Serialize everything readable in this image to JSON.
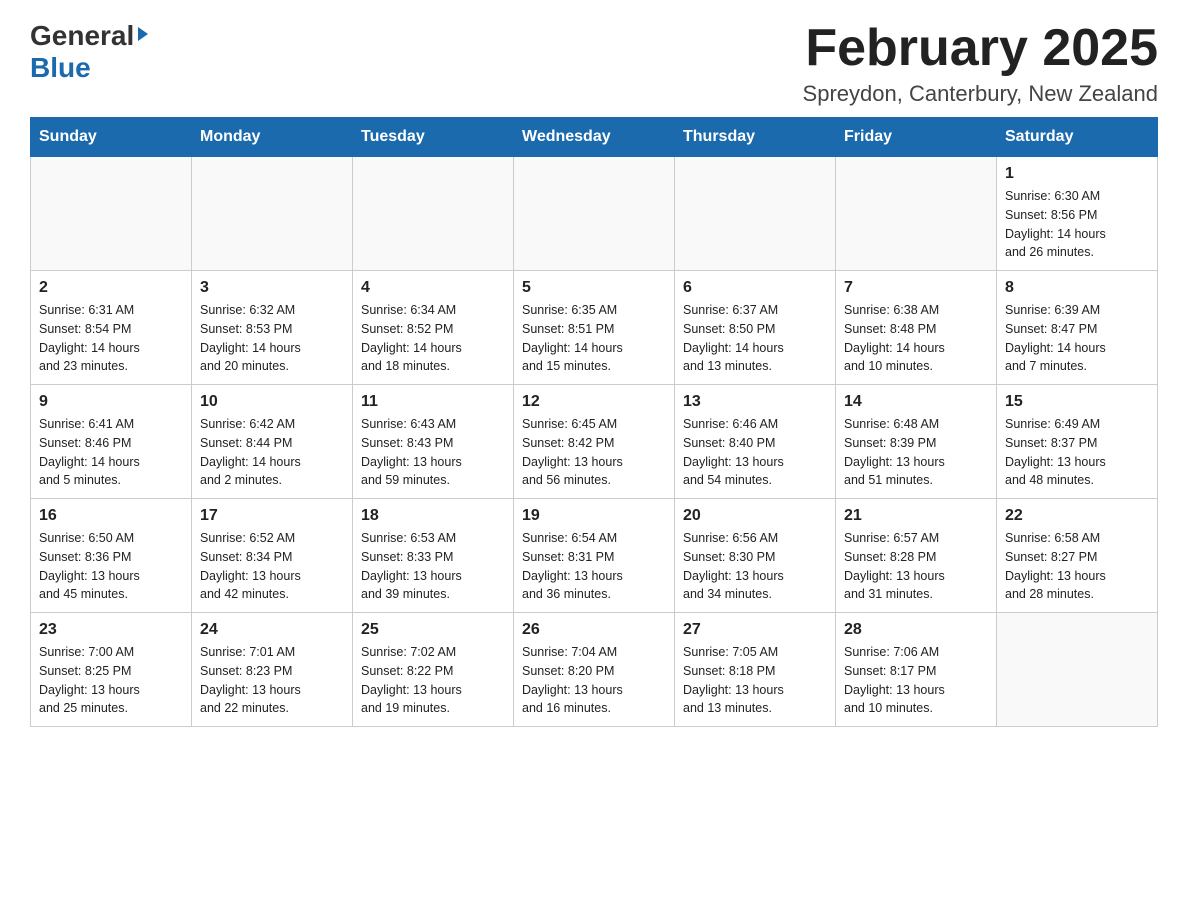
{
  "header": {
    "logo_text_dark": "General",
    "logo_text_blue": "Blue",
    "month_year": "February 2025",
    "location": "Spreydon, Canterbury, New Zealand"
  },
  "calendar": {
    "days_of_week": [
      "Sunday",
      "Monday",
      "Tuesday",
      "Wednesday",
      "Thursday",
      "Friday",
      "Saturday"
    ],
    "weeks": [
      [
        {
          "day": "",
          "info": ""
        },
        {
          "day": "",
          "info": ""
        },
        {
          "day": "",
          "info": ""
        },
        {
          "day": "",
          "info": ""
        },
        {
          "day": "",
          "info": ""
        },
        {
          "day": "",
          "info": ""
        },
        {
          "day": "1",
          "info": "Sunrise: 6:30 AM\nSunset: 8:56 PM\nDaylight: 14 hours\nand 26 minutes."
        }
      ],
      [
        {
          "day": "2",
          "info": "Sunrise: 6:31 AM\nSunset: 8:54 PM\nDaylight: 14 hours\nand 23 minutes."
        },
        {
          "day": "3",
          "info": "Sunrise: 6:32 AM\nSunset: 8:53 PM\nDaylight: 14 hours\nand 20 minutes."
        },
        {
          "day": "4",
          "info": "Sunrise: 6:34 AM\nSunset: 8:52 PM\nDaylight: 14 hours\nand 18 minutes."
        },
        {
          "day": "5",
          "info": "Sunrise: 6:35 AM\nSunset: 8:51 PM\nDaylight: 14 hours\nand 15 minutes."
        },
        {
          "day": "6",
          "info": "Sunrise: 6:37 AM\nSunset: 8:50 PM\nDaylight: 14 hours\nand 13 minutes."
        },
        {
          "day": "7",
          "info": "Sunrise: 6:38 AM\nSunset: 8:48 PM\nDaylight: 14 hours\nand 10 minutes."
        },
        {
          "day": "8",
          "info": "Sunrise: 6:39 AM\nSunset: 8:47 PM\nDaylight: 14 hours\nand 7 minutes."
        }
      ],
      [
        {
          "day": "9",
          "info": "Sunrise: 6:41 AM\nSunset: 8:46 PM\nDaylight: 14 hours\nand 5 minutes."
        },
        {
          "day": "10",
          "info": "Sunrise: 6:42 AM\nSunset: 8:44 PM\nDaylight: 14 hours\nand 2 minutes."
        },
        {
          "day": "11",
          "info": "Sunrise: 6:43 AM\nSunset: 8:43 PM\nDaylight: 13 hours\nand 59 minutes."
        },
        {
          "day": "12",
          "info": "Sunrise: 6:45 AM\nSunset: 8:42 PM\nDaylight: 13 hours\nand 56 minutes."
        },
        {
          "day": "13",
          "info": "Sunrise: 6:46 AM\nSunset: 8:40 PM\nDaylight: 13 hours\nand 54 minutes."
        },
        {
          "day": "14",
          "info": "Sunrise: 6:48 AM\nSunset: 8:39 PM\nDaylight: 13 hours\nand 51 minutes."
        },
        {
          "day": "15",
          "info": "Sunrise: 6:49 AM\nSunset: 8:37 PM\nDaylight: 13 hours\nand 48 minutes."
        }
      ],
      [
        {
          "day": "16",
          "info": "Sunrise: 6:50 AM\nSunset: 8:36 PM\nDaylight: 13 hours\nand 45 minutes."
        },
        {
          "day": "17",
          "info": "Sunrise: 6:52 AM\nSunset: 8:34 PM\nDaylight: 13 hours\nand 42 minutes."
        },
        {
          "day": "18",
          "info": "Sunrise: 6:53 AM\nSunset: 8:33 PM\nDaylight: 13 hours\nand 39 minutes."
        },
        {
          "day": "19",
          "info": "Sunrise: 6:54 AM\nSunset: 8:31 PM\nDaylight: 13 hours\nand 36 minutes."
        },
        {
          "day": "20",
          "info": "Sunrise: 6:56 AM\nSunset: 8:30 PM\nDaylight: 13 hours\nand 34 minutes."
        },
        {
          "day": "21",
          "info": "Sunrise: 6:57 AM\nSunset: 8:28 PM\nDaylight: 13 hours\nand 31 minutes."
        },
        {
          "day": "22",
          "info": "Sunrise: 6:58 AM\nSunset: 8:27 PM\nDaylight: 13 hours\nand 28 minutes."
        }
      ],
      [
        {
          "day": "23",
          "info": "Sunrise: 7:00 AM\nSunset: 8:25 PM\nDaylight: 13 hours\nand 25 minutes."
        },
        {
          "day": "24",
          "info": "Sunrise: 7:01 AM\nSunset: 8:23 PM\nDaylight: 13 hours\nand 22 minutes."
        },
        {
          "day": "25",
          "info": "Sunrise: 7:02 AM\nSunset: 8:22 PM\nDaylight: 13 hours\nand 19 minutes."
        },
        {
          "day": "26",
          "info": "Sunrise: 7:04 AM\nSunset: 8:20 PM\nDaylight: 13 hours\nand 16 minutes."
        },
        {
          "day": "27",
          "info": "Sunrise: 7:05 AM\nSunset: 8:18 PM\nDaylight: 13 hours\nand 13 minutes."
        },
        {
          "day": "28",
          "info": "Sunrise: 7:06 AM\nSunset: 8:17 PM\nDaylight: 13 hours\nand 10 minutes."
        },
        {
          "day": "",
          "info": ""
        }
      ]
    ]
  }
}
